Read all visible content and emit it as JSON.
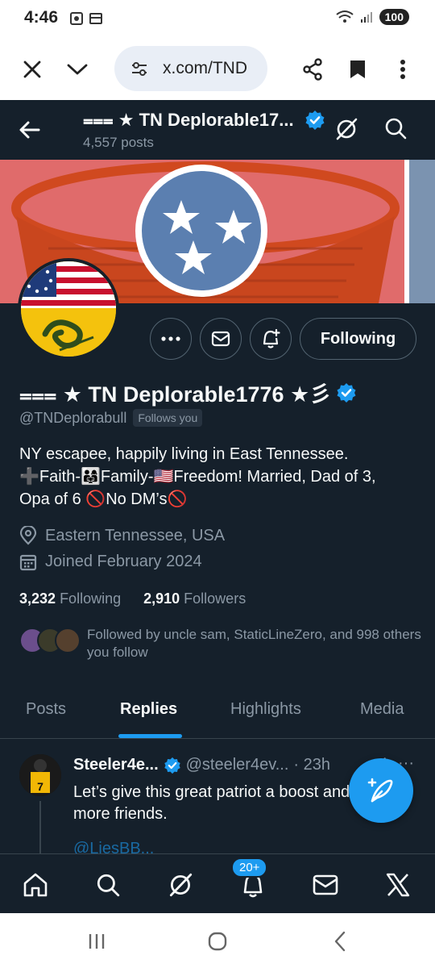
{
  "status_bar": {
    "time": "4:46",
    "battery": "100"
  },
  "browser": {
    "url": "x.com/TND"
  },
  "header": {
    "title": "⩶ ★ TN Deplorable17...",
    "posts_count": "4,557 posts"
  },
  "profile": {
    "following_button": "Following",
    "display_name": "⩶ ★ TN Deplorable1776 ★彡",
    "handle": "@TNDeplorabull",
    "follows_you": "Follows you",
    "bio_line1": "NY escapee, happily living in East Tennessee.",
    "bio_line2_a": "➕Faith-",
    "bio_line2_b": "👨‍👩‍👧Family-",
    "bio_line2_c": "🇺🇸Freedom! Married, Dad of 3,",
    "bio_line3_a": "Opa of 6  ",
    "bio_line3_no1": "🚫",
    "bio_line3_b": "No DM’s",
    "bio_line3_no2": "🚫",
    "location": "Eastern Tennessee, USA",
    "joined": "Joined February 2024",
    "following_count": "3,232",
    "following_label": "Following",
    "followers_count": "2,910",
    "followers_label": "Followers",
    "followed_by": "Followed by uncle sam, StaticLineZero, and 998 others you follow"
  },
  "tabs": [
    {
      "label": "Posts"
    },
    {
      "label": "Replies"
    },
    {
      "label": "Highlights"
    },
    {
      "label": "Media"
    }
  ],
  "reply": {
    "name": "Steeler4e...",
    "handle": "@steeler4ev...",
    "time": "· 23h",
    "more": "···",
    "text": "Let’s give this great patriot a boost and more friends.",
    "link_preview": "@LiesBB..."
  },
  "bottom_nav": {
    "notifications_badge": "20+"
  },
  "colors": {
    "app_background": "#15202b",
    "accent": "#1d9bf0",
    "secondary_text": "#8b98a5",
    "banner_red": "#e06b6b",
    "tn_blue": "#5b7fb0"
  },
  "icons": [
    "close-icon",
    "chevron-down-icon",
    "site-settings-icon",
    "share-icon",
    "bookmark-icon",
    "overflow-icon",
    "back-arrow-icon",
    "verified-badge-icon",
    "grok-icon",
    "search-icon",
    "more-icon",
    "message-icon",
    "notify-bell-icon",
    "location-icon",
    "calendar-icon",
    "compose-icon",
    "home-icon",
    "bell-icon",
    "mail-icon",
    "x-logo-icon"
  ]
}
